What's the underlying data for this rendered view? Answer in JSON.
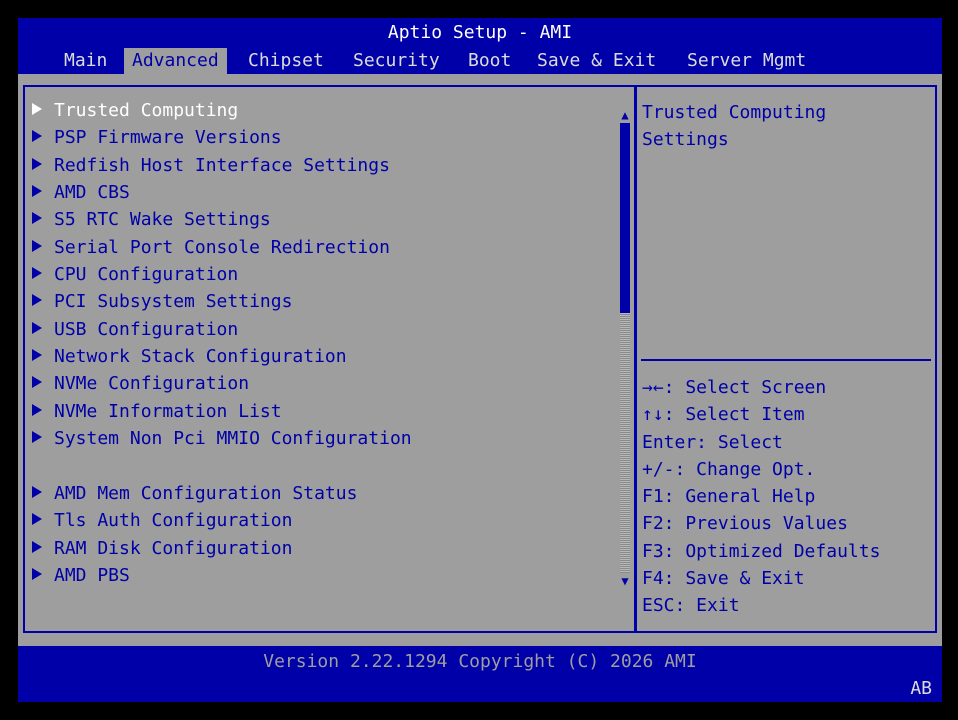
{
  "header": {
    "title": "Aptio Setup - AMI"
  },
  "tabs": [
    {
      "label": "Main"
    },
    {
      "label": "Advanced"
    },
    {
      "label": "Chipset"
    },
    {
      "label": "Security"
    },
    {
      "label": "Boot"
    },
    {
      "label": "Save & Exit"
    },
    {
      "label": "Server Mgmt"
    }
  ],
  "active_tab": "Advanced",
  "menu": {
    "items": [
      {
        "label": "Trusted Computing"
      },
      {
        "label": "PSP Firmware Versions"
      },
      {
        "label": "Redfish Host Interface Settings"
      },
      {
        "label": "AMD CBS"
      },
      {
        "label": "S5 RTC Wake Settings"
      },
      {
        "label": "Serial Port Console Redirection"
      },
      {
        "label": "CPU Configuration"
      },
      {
        "label": "PCI Subsystem Settings"
      },
      {
        "label": "USB Configuration"
      },
      {
        "label": "Network Stack Configuration"
      },
      {
        "label": "NVMe Configuration"
      },
      {
        "label": "NVMe Information List"
      },
      {
        "label": "System Non Pci MMIO Configuration"
      },
      {
        "label": "AMD Mem Configuration Status"
      },
      {
        "label": "Tls Auth Configuration"
      },
      {
        "label": "RAM Disk Configuration"
      },
      {
        "label": "AMD PBS"
      }
    ],
    "selected": "Trusted Computing"
  },
  "help": {
    "line1": "Trusted Computing",
    "line2": "Settings"
  },
  "keys": [
    {
      "text": "→←: Select Screen"
    },
    {
      "text": "↑↓: Select Item"
    },
    {
      "text": "Enter: Select"
    },
    {
      "text": "+/-: Change Opt."
    },
    {
      "text": "F1: General Help"
    },
    {
      "text": "F2: Previous Values"
    },
    {
      "text": "F3: Optimized Defaults"
    },
    {
      "text": "F4: Save & Exit"
    },
    {
      "text": "ESC: Exit"
    }
  ],
  "footer": {
    "version": "Version 2.22.1294 Copyright (C) 2026 AMI",
    "code": "AB"
  },
  "colors": {
    "blue": "#0000a8",
    "gray": "#9e9e9e",
    "white": "#ffffff"
  }
}
